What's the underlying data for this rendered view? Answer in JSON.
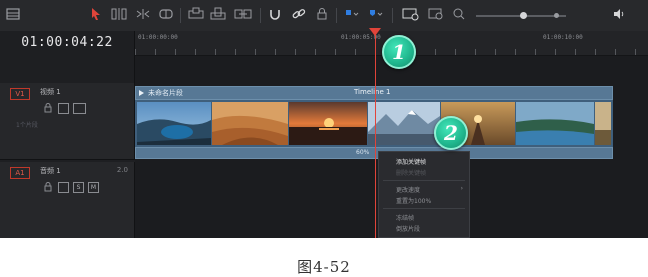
{
  "timecode": "01:00:04:22",
  "ruler": {
    "labels": [
      "01:00:00:00",
      "01:00:05:00",
      "01:00:10:00"
    ]
  },
  "tracks": {
    "video": {
      "badge": "V1",
      "name": "视频 1",
      "sub": "1个片段"
    },
    "audio": {
      "badge": "A1",
      "name": "音频 1",
      "count": "2.0",
      "ctrl_s": "S",
      "ctrl_m": "M"
    }
  },
  "clip": {
    "title": "未命名片段",
    "timeline_name": "Timeline 1",
    "footer": "60%"
  },
  "context_menu": {
    "items": [
      {
        "label": "添加关键帧"
      },
      {
        "label": "删除关键帧"
      },
      {
        "label": "更改速度"
      },
      {
        "label": "重置为100%"
      },
      {
        "label": "冻结帧"
      },
      {
        "label": "倒放片段"
      }
    ]
  },
  "markers": [
    "1",
    "2"
  ],
  "caption": "图4-52",
  "colors": {
    "playhead": "#e0443a",
    "clip": "#577895",
    "marker": "#1fb58c"
  },
  "toolbar_icons": [
    "timeline-layout-icon",
    "select-pointer-icon",
    "trim-icon",
    "dynamic-trim-icon",
    "blade-icon",
    "insert-clip-icon",
    "overwrite-clip-icon",
    "replace-clip-icon",
    "snapping-icon",
    "linked-selection-icon",
    "position-lock-icon",
    "flag-icon",
    "marker-icon",
    "zoom-full-icon",
    "zoom-detail-icon",
    "zoom-custom-icon",
    "audio-icon"
  ]
}
